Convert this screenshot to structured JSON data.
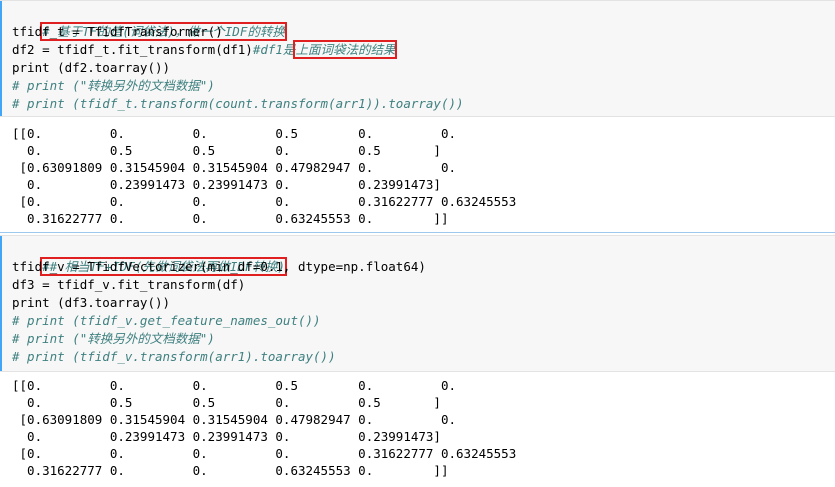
{
  "cell1": {
    "comment1": "# 基于TF的值(词袋法)，做一个IDF的转换",
    "line2": "tfidf_t = TfidfTransformer()",
    "line3_code": "df2 = tfidf_t.fit_transform(df1)",
    "line3_comment_a": "#df1是",
    "line3_comment_b": "上面词袋法的结果",
    "line4": "print (df2.toarray())",
    "line5": "# print (\"转换另外的文档数据\")",
    "line6": "# print (tfidf_t.transform(count.transform(arr1)).toarray())"
  },
  "output1": [
    "[[0.         0.         0.         0.5        0.         0.",
    "  0.         0.5        0.5        0.         0.5       ]",
    " [0.63091809 0.31545904 0.31545904 0.47982947 0.         0.",
    "  0.         0.23991473 0.23991473 0.         0.23991473]",
    " [0.         0.         0.         0.         0.31622777 0.63245553",
    "  0.31622777 0.         0.         0.63245553 0.        ]]"
  ],
  "cell2": {
    "comment1": "## 相当TF+IDF(先做词袋法再做IDF转换)",
    "line2": "tfidf_v = TfidfVectorizer(min_df=0.1, dtype=np.float64)",
    "line3": "df3 = tfidf_v.fit_transform(df)",
    "line4": "print (df3.toarray())",
    "line5": "# print (tfidf_v.get_feature_names_out())",
    "line6": "# print (\"转换另外的文档数据\")",
    "line7": "# print (tfidf_v.transform(arr1).toarray())"
  },
  "output2": [
    "[[0.         0.         0.         0.5        0.         0.",
    "  0.         0.5        0.5        0.         0.5       ]",
    " [0.63091809 0.31545904 0.31545904 0.47982947 0.         0.",
    "  0.         0.23991473 0.23991473 0.         0.23991473]",
    " [0.         0.         0.         0.         0.31622777 0.63245553",
    "  0.31622777 0.         0.         0.63245553 0.        ]]"
  ],
  "colors": {
    "highlight_box": "#e02020",
    "comment": "#408080",
    "cell_background": "#f7f7f7",
    "active_cell_bar": "#42a5f5"
  }
}
